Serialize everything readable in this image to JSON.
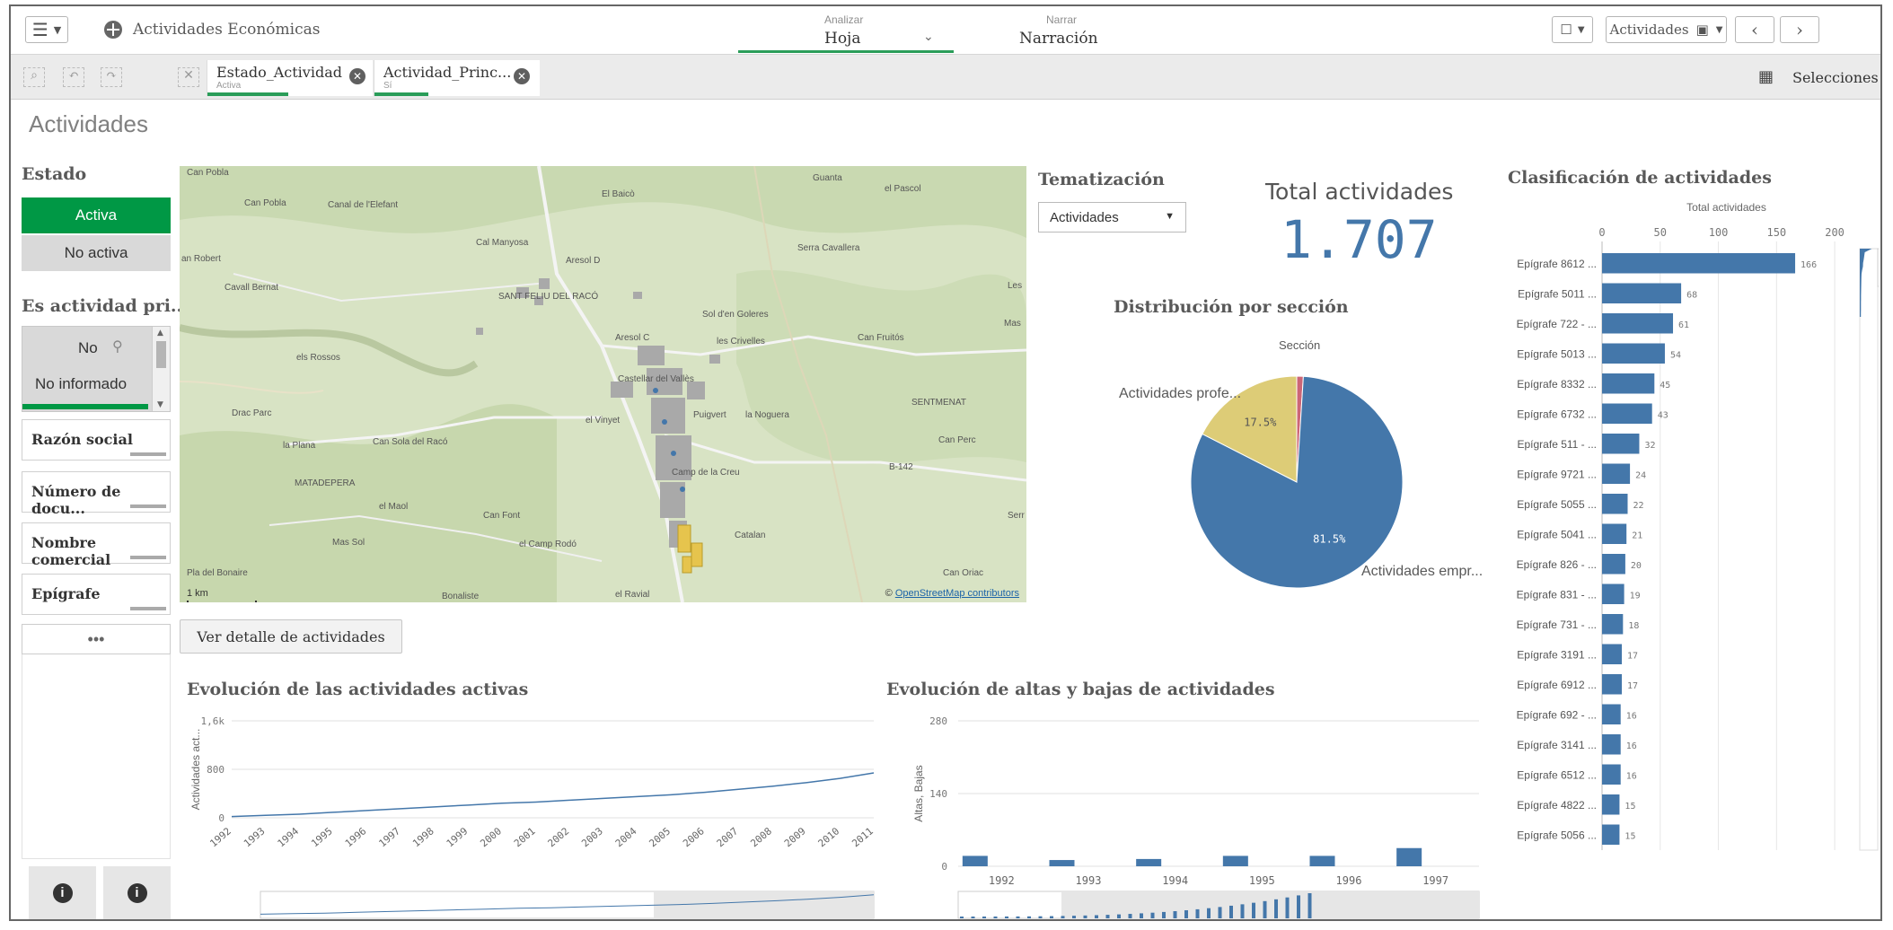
{
  "topbar": {
    "menu_icon": "hamburger-menu-icon",
    "app_title": "Actividades Económicas",
    "tabs": [
      {
        "small": "Analizar",
        "label": "Hoja"
      },
      {
        "small": "Narrar",
        "label": "Narración"
      }
    ],
    "sheet_button_label": "Actividades",
    "bookmark_icon": "bookmark-icon",
    "prev_icon": "chevron-left-icon",
    "next_icon": "chevron-right-icon"
  },
  "selection_bar": {
    "chips": [
      {
        "field": "Estado_Actividad",
        "value": "Activa"
      },
      {
        "field": "Actividad_Princ...",
        "value": "Sí"
      }
    ],
    "selections_label": "Selecciones"
  },
  "sheet_title": "Actividades",
  "filters": {
    "estado": {
      "title": "Estado",
      "options": [
        {
          "label": "Activa",
          "selected": true
        },
        {
          "label": "No activa",
          "selected": false
        }
      ]
    },
    "es_actividad": {
      "title": "Es actividad pri...",
      "options": [
        "No",
        "No informado"
      ]
    },
    "fields": [
      "Razón social",
      "Número de docu...",
      "Nombre comercial",
      "Epígrafe"
    ],
    "more_label": "•••"
  },
  "map": {
    "labels": [
      "Can Pobla",
      "Can Pobla",
      "Canal de l'Elefant",
      "El Baicò",
      "Guanta",
      "el Pascol",
      "Cal Manyosa",
      "Serra Cavallera",
      "an Robert",
      "Aresol D",
      "Cavall Bernat",
      "SANT FELIU DEL RACÓ",
      "Sol d'en Goleres",
      "Les",
      "Mas",
      "Aresol C",
      "les Crivelles",
      "Can Fruitós",
      "els Rossos",
      "Castellar del Vallès",
      "Drac Parc",
      "el Vinyet",
      "Puigvert",
      "la Noguera",
      "SENTMENAT",
      "Can Sola del Racó",
      "la Plana",
      "Can Perc",
      "Camp de la Creu",
      "B-142",
      "MATADEPERA",
      "el Maol",
      "Can Font",
      "Serr",
      "Mas Sol",
      "el Camp Rodó",
      "Catalan",
      "Pla del Bonaire",
      "Can Oriac",
      "el Ravial",
      "Bonaliste"
    ],
    "scale": "1 km",
    "attribution_prefix": "© ",
    "attribution_link": "OpenStreetMap contributors"
  },
  "detail_button": "Ver detalle de actividades",
  "tematizacion": {
    "title": "Tematización",
    "selected": "Actividades"
  },
  "kpi": {
    "label": "Total actividades",
    "value": "1.707"
  },
  "pie": {
    "title": "Distribución por sección",
    "legend_title": "Sección",
    "label_a": "Actividades profe...",
    "label_b": "Actividades empr..."
  },
  "line_chart": {
    "title": "Evolución de las actividades activas"
  },
  "bar_chart": {
    "title": "Evolución de altas y bajas de actividades"
  },
  "clasificacion": {
    "title": "Clasificación de actividades"
  },
  "chart_data": [
    {
      "type": "pie",
      "title": "Distribución por sección",
      "legend_title": "Sección",
      "slices": [
        {
          "name": "Actividades empr...",
          "pct": 81.5,
          "label": "81.5%",
          "color": "#4477aa"
        },
        {
          "name": "Actividades profe...",
          "pct": 17.5,
          "label": "17.5%",
          "color": "#ddcc77"
        },
        {
          "name": "",
          "pct": 1.0,
          "label": "",
          "color": "#cc6677"
        }
      ]
    },
    {
      "type": "line",
      "title": "Evolución de las actividades activas",
      "ylabel": "Actividades act...",
      "yticks": [
        "0",
        "800",
        "1,6k"
      ],
      "ylim": [
        0,
        1600
      ],
      "x": [
        "1992",
        "1993",
        "1994",
        "1995",
        "1996",
        "1997",
        "1998",
        "1999",
        "2000",
        "2001",
        "2002",
        "2003",
        "2004",
        "2005",
        "2006",
        "2007",
        "2008",
        "2009",
        "2010",
        "2011"
      ],
      "values": [
        20,
        40,
        60,
        90,
        120,
        150,
        180,
        210,
        240,
        260,
        290,
        320,
        350,
        380,
        420,
        470,
        520,
        580,
        650,
        740
      ],
      "color": "#4477aa"
    },
    {
      "type": "bar",
      "title": "Evolución de altas y bajas de actividades",
      "ylabel": "Altas, Bajas",
      "yticks": [
        "0",
        "140",
        "280"
      ],
      "ylim": [
        0,
        280
      ],
      "categories": [
        "1992",
        "1993",
        "1994",
        "1995",
        "1996",
        "1997"
      ],
      "values": [
        20,
        12,
        14,
        20,
        20,
        35
      ],
      "color": "#4477aa"
    },
    {
      "type": "bar",
      "orientation": "horizontal",
      "title": "Clasificación de actividades",
      "xlabel": "Total actividades",
      "xticks": [
        "0",
        "50",
        "100",
        "150",
        "200"
      ],
      "xlim": [
        0,
        220
      ],
      "categories": [
        "Epígrafe 8612 ...",
        "Epígrafe 5011 ...",
        "Epígrafe 722 - ...",
        "Epígrafe 5013 ...",
        "Epígrafe 8332 ...",
        "Epígrafe 6732 ...",
        "Epígrafe 511 - ...",
        "Epígrafe 9721 ...",
        "Epígrafe 5055 ...",
        "Epígrafe 5041 ...",
        "Epígrafe 826 - ...",
        "Epígrafe 831 - ...",
        "Epígrafe 731 - ...",
        "Epígrafe 3191 ...",
        "Epígrafe 6912 ...",
        "Epígrafe 692 - ...",
        "Epígrafe 3141 ...",
        "Epígrafe 6512 ...",
        "Epígrafe 4822 ...",
        "Epígrafe 5056 ..."
      ],
      "values": [
        166,
        68,
        61,
        54,
        45,
        43,
        32,
        24,
        22,
        21,
        20,
        19,
        18,
        17,
        17,
        16,
        16,
        16,
        15,
        15
      ],
      "color": "#4477aa"
    }
  ]
}
